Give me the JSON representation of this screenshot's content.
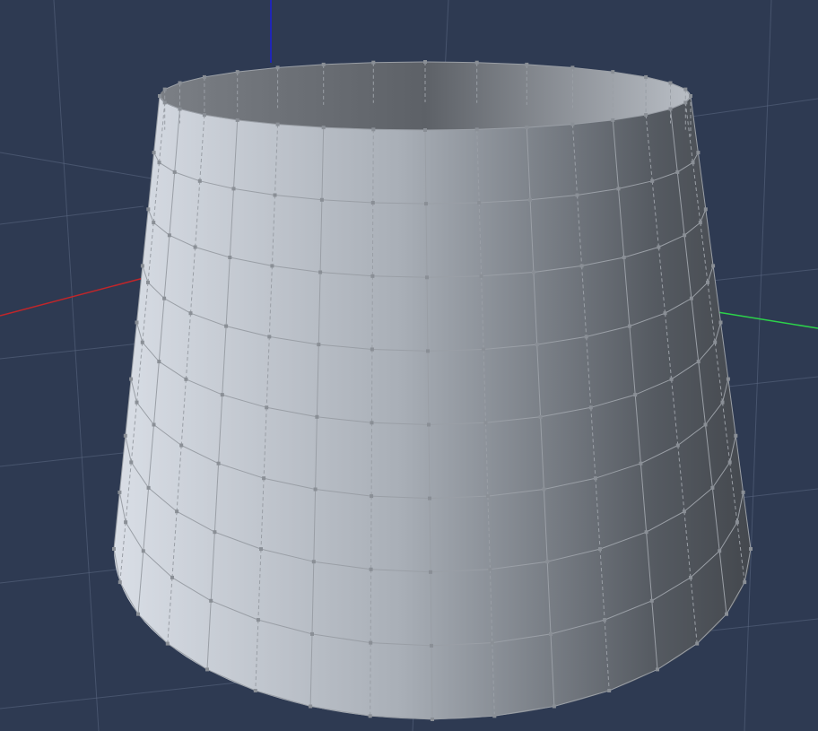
{
  "viewport": {
    "background": "#2e3a52",
    "grid_color": "#5d6a84",
    "mesh_edge_color": "#9a9fa6",
    "vertex_color": "#8a8f96"
  },
  "axes": {
    "x": {
      "color": "#c0262a"
    },
    "y": {
      "color": "#2cd24a"
    },
    "z": {
      "color": "#1c1fd6"
    }
  },
  "object": {
    "type": "truncated cone (frustum)",
    "surface_light": "#d9dee6",
    "surface_mid": "#a9afb7",
    "surface_dark": "#555a61",
    "surface_shadow": "#44484e",
    "interior": "#8a8e93",
    "height_segments": 8,
    "radial_segments": 32
  }
}
